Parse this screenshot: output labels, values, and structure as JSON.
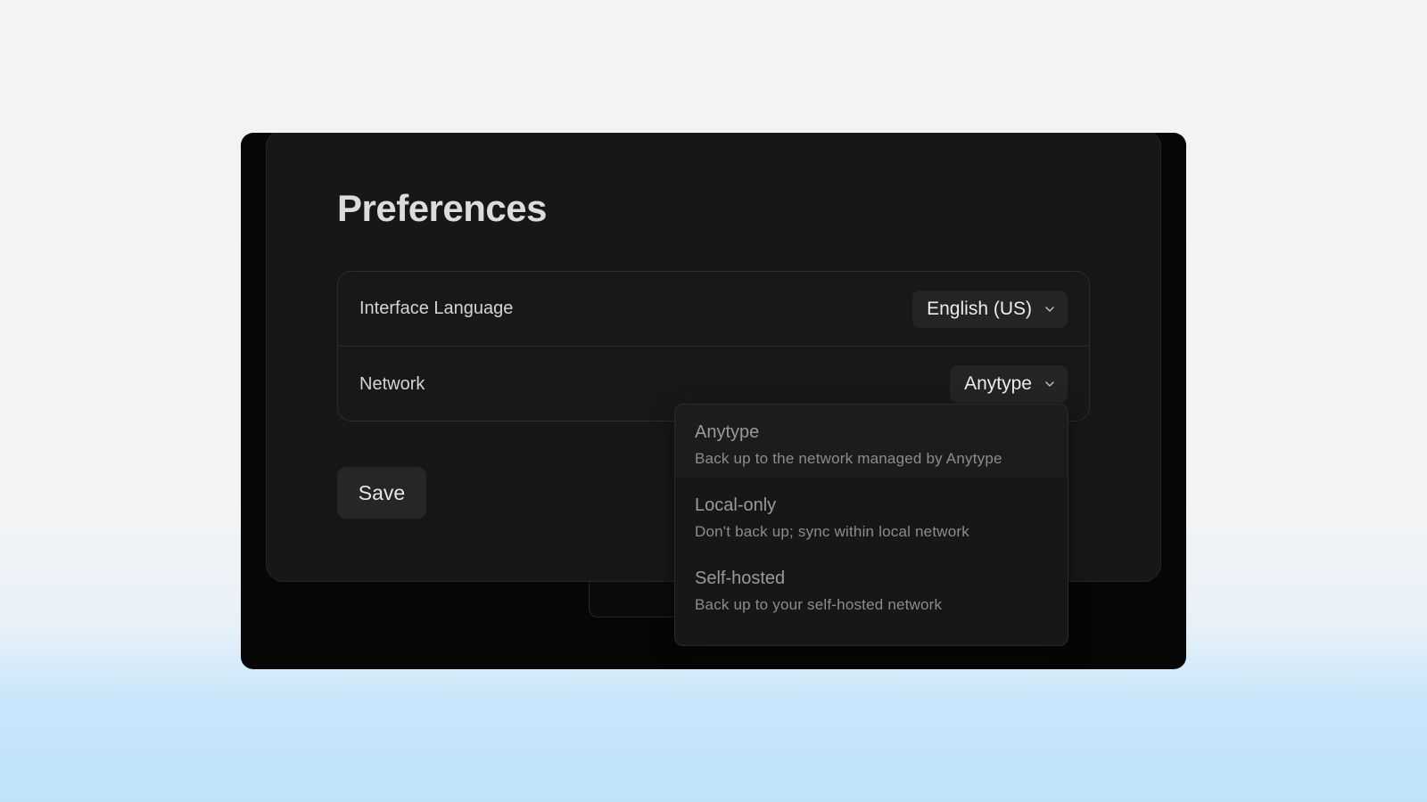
{
  "page": {
    "title": "Preferences",
    "save_label": "Save"
  },
  "settings": {
    "language": {
      "label": "Interface Language",
      "value": "English (US)"
    },
    "network": {
      "label": "Network",
      "value": "Anytype"
    }
  },
  "network_options": [
    {
      "title": "Anytype",
      "description": "Back up to the network managed by Anytype",
      "selected": true
    },
    {
      "title": "Local-only",
      "description": "Don't back up; sync within local network",
      "selected": false
    },
    {
      "title": "Self-hosted",
      "description": "Back up to your self-hosted network",
      "selected": false
    }
  ],
  "icons": {
    "select_chevron": "chevron-down-icon"
  },
  "colors": {
    "window_bg": "#060606",
    "card_bg": "#171717",
    "control_bg": "#242424",
    "text": "#dcdcdc"
  }
}
